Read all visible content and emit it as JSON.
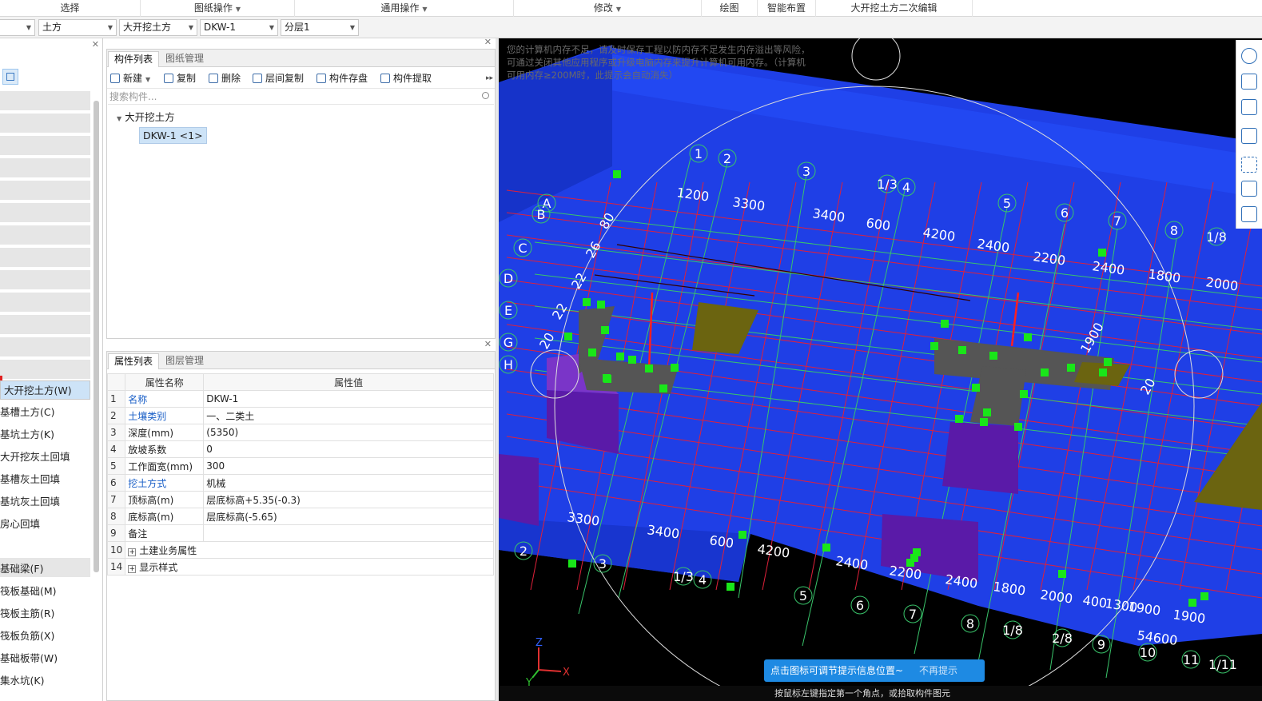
{
  "menubar": {
    "items": [
      {
        "label": "选择",
        "dropdown": false
      },
      {
        "label": "图纸操作",
        "dropdown": true
      },
      {
        "label": "通用操作",
        "dropdown": true
      },
      {
        "label": "修改",
        "dropdown": true
      },
      {
        "label": "绘图",
        "dropdown": false
      },
      {
        "label": "智能布置",
        "dropdown": false
      },
      {
        "label": "大开挖土方二次编辑",
        "dropdown": false
      }
    ]
  },
  "selectors": [
    "",
    "土方",
    "大开挖土方",
    "DKW-1",
    "分层1"
  ],
  "left_panel": {
    "items": [
      "大开挖土方(W)",
      "基槽土方(C)",
      "基坑土方(K)",
      "大开挖灰土回填",
      "基槽灰土回填",
      "基坑灰土回填",
      "房心回填",
      "",
      "基础梁(F)",
      "筏板基础(M)",
      "筏板主筋(R)",
      "筏板负筋(X)",
      "基础板带(W)",
      "集水坑(K)"
    ],
    "selected": "大开挖土方(W)"
  },
  "component_panel": {
    "tabs": [
      "构件列表",
      "图纸管理"
    ],
    "toolbar": [
      "新建",
      "复制",
      "删除",
      "层间复制",
      "构件存盘",
      "构件提取"
    ],
    "search_placeholder": "搜索构件...",
    "tree_root": "大开挖土方",
    "tree_node": "DKW-1 <1>"
  },
  "property_panel": {
    "tabs": [
      "属性列表",
      "图层管理"
    ],
    "headers": [
      "属性名称",
      "属性值"
    ],
    "rows": [
      {
        "num": "1",
        "name": "名称",
        "value": "DKW-1",
        "link": true,
        "expand": false
      },
      {
        "num": "2",
        "name": "土壤类别",
        "value": "一、二类土",
        "link": true,
        "expand": false
      },
      {
        "num": "3",
        "name": "深度(mm)",
        "value": "(5350)",
        "link": false,
        "expand": false
      },
      {
        "num": "4",
        "name": "放坡系数",
        "value": "0",
        "link": false,
        "expand": false
      },
      {
        "num": "5",
        "name": "工作面宽(mm)",
        "value": "300",
        "link": false,
        "expand": false
      },
      {
        "num": "6",
        "name": "挖土方式",
        "value": "机械",
        "link": true,
        "expand": false
      },
      {
        "num": "7",
        "name": "顶标高(m)",
        "value": "层底标高+5.35(-0.3)",
        "link": false,
        "expand": false
      },
      {
        "num": "8",
        "name": "底标高(m)",
        "value": "层底标高(-5.65)",
        "link": false,
        "expand": false
      },
      {
        "num": "9",
        "name": "备注",
        "value": "",
        "link": false,
        "expand": false
      },
      {
        "num": "10",
        "name": "土建业务属性",
        "value": "",
        "link": false,
        "expand": true
      },
      {
        "num": "14",
        "name": "显示样式",
        "value": "",
        "link": false,
        "expand": true
      }
    ]
  },
  "viewport": {
    "warning": "您的计算机内存不足，请及时保存工程以防内存不足发生内存溢出等风险，可通过关闭其他应用程序或升级电脑内存来提升计算机可用内存。（计算机可用内存≥200M时，此提示会自动消失）",
    "tip": "点击图标可调节提示信息位置~",
    "tip_dismiss": "不再提示",
    "status": "按鼠标左键指定第一个角点，或拾取构件图元",
    "axis_top": [
      "1",
      "2",
      "3",
      "1/3",
      "4",
      "5",
      "6",
      "7",
      "8",
      "1/8"
    ],
    "axis_left": [
      "A",
      "B",
      "C",
      "D",
      "E",
      "G",
      "H"
    ],
    "axis_bottom": [
      "2",
      "3",
      "1/3",
      "4",
      "5",
      "6",
      "7",
      "8",
      "1/8",
      "2/8",
      "9",
      "10",
      "11",
      "1/11"
    ],
    "dims_top": [
      "1200",
      "3300",
      "3400",
      "600",
      "4200",
      "2400",
      "2200",
      "2400",
      "1800",
      "2000"
    ],
    "dims_bottom": [
      "3300",
      "3400",
      "600",
      "4200",
      "2400",
      "2200",
      "2400",
      "1800",
      "2000",
      "400",
      "1300",
      "1900",
      "1900",
      "54600"
    ],
    "dims_side": [
      "26",
      "80",
      "22",
      "22",
      "20",
      "1900",
      "20"
    ],
    "axes_gizmo": {
      "x": "X",
      "y": "Y",
      "z": "Z"
    },
    "colors": {
      "slab": "#1f3fe6",
      "slab_top": "#2952ff",
      "grid_red": "#e0203a",
      "grid_green": "#39c46a",
      "pit": "#5a1aa8",
      "beam": "#5a5a5a",
      "olive": "#6b6410",
      "handle": "#19e619"
    }
  }
}
